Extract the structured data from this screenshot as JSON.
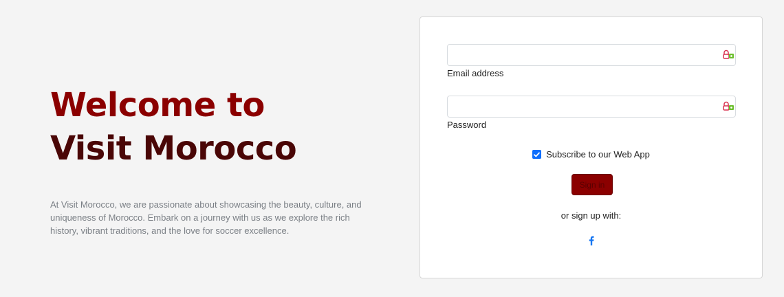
{
  "hero": {
    "title_line1": "Welcome to",
    "title_line2": "Visit Morocco",
    "description": "At Visit Morocco, we are passionate about showcasing the beauty, culture, and uniqueness of Morocco. Embark on a journey with us as we explore the rich history, vibrant traditions, and the love for soccer excellence."
  },
  "form": {
    "email": {
      "label": "Email address",
      "value": "",
      "placeholder": ""
    },
    "password": {
      "label": "Password",
      "value": "",
      "placeholder": ""
    },
    "subscribe": {
      "label": "Subscribe to our Web App",
      "checked": true
    },
    "signin_label": "Sign in",
    "or_text": "or sign up with:",
    "social_icon": "facebook-icon"
  },
  "colors": {
    "accent": "#8b0000",
    "title_dark": "#4a0606",
    "checkbox": "#0d6efd",
    "facebook": "#1877f2",
    "background": "#f4f4f4"
  }
}
